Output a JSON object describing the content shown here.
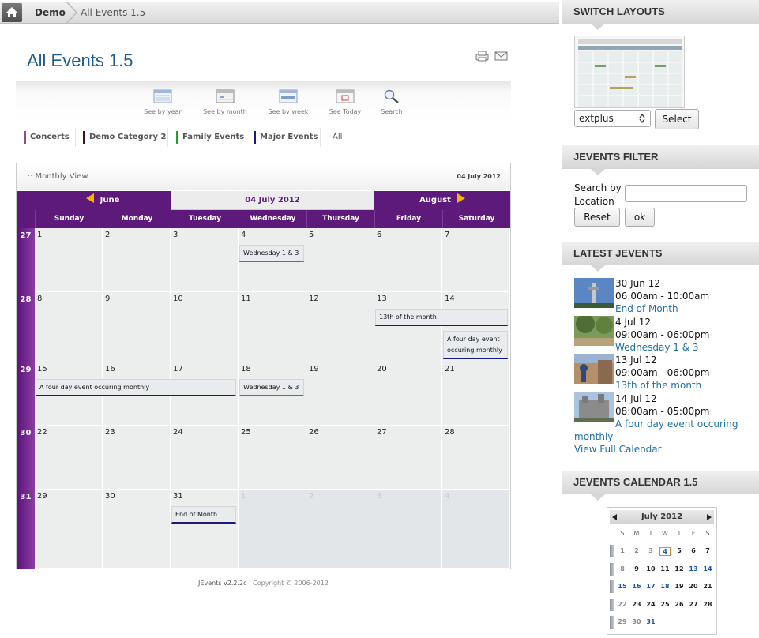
{
  "breadcrumb": {
    "demo": "Demo",
    "current": "All Events 1.5"
  },
  "page": {
    "title": "All Events 1.5"
  },
  "nav": [
    {
      "label": "See by year"
    },
    {
      "label": "See by month"
    },
    {
      "label": "See by week"
    },
    {
      "label": "See Today"
    },
    {
      "label": "Search"
    }
  ],
  "categories": [
    {
      "label": "Concerts",
      "color": "#8a4b8e"
    },
    {
      "label": "Demo Category 2",
      "color": "#4a1010"
    },
    {
      "label": "Family Events",
      "color": "#2e9a2e"
    },
    {
      "label": "Major Events",
      "color": "#1a1a7a"
    },
    {
      "label": "All",
      "color": ""
    }
  ],
  "calendar": {
    "view_label": "Monthly View",
    "date_label": "04 July 2012",
    "prev_month": "June",
    "current": "04 July 2012",
    "next_month": "August",
    "days": [
      "Sunday",
      "Monday",
      "Tuesday",
      "Wednesday",
      "Thursday",
      "Friday",
      "Saturday"
    ],
    "weeks": [
      {
        "num": "27",
        "days": [
          "1",
          "2",
          "3",
          "4",
          "5",
          "6",
          "7"
        ]
      },
      {
        "num": "28",
        "days": [
          "8",
          "9",
          "10",
          "11",
          "12",
          "13",
          "14"
        ]
      },
      {
        "num": "29",
        "days": [
          "15",
          "16",
          "17",
          "18",
          "19",
          "20",
          "21"
        ]
      },
      {
        "num": "30",
        "days": [
          "22",
          "23",
          "24",
          "25",
          "26",
          "27",
          "28"
        ]
      },
      {
        "num": "31",
        "days": [
          "29",
          "30",
          "31",
          "1",
          "2",
          "3",
          "4"
        ]
      }
    ],
    "events": {
      "wed1": "Wednesday 1 & 3",
      "thirteenth": "13th of the month",
      "fourday_short": "A four day event occuring monthly",
      "fourday_long": "A four day event occuring monthly",
      "wed2": "Wednesday 1 & 3",
      "eom": "End of Month"
    },
    "event_colors": {
      "green": "#2e9a2e",
      "navy": "#1a1a7a"
    }
  },
  "footer": {
    "version": "JEvents v2.2.2c",
    "copyright": "Copyright © 2006-2012"
  },
  "sidebar": {
    "switch_layouts": {
      "title": "SWITCH LAYOUTS",
      "selected": "extplus",
      "button": "Select"
    },
    "filter": {
      "title": "JEVENTS FILTER",
      "label": "Search by Location",
      "reset": "Reset",
      "ok": "ok"
    },
    "latest": {
      "title": "LATEST JEVENTS",
      "items": [
        {
          "date": "30 Jun 12",
          "time": "06:00am - 10:00am",
          "title": "End of Month"
        },
        {
          "date": "4 Jul 12",
          "time": "09:00am - 06:00pm",
          "title": "Wednesday 1 & 3"
        },
        {
          "date": "13 Jul 12",
          "time": "09:00am - 06:00pm",
          "title": "13th of the month"
        },
        {
          "date": "14 Jul 12",
          "time": "08:00am - 05:00pm",
          "title_line1": "A four day event occuring",
          "title_line2": "monthly"
        }
      ],
      "view_full": "View Full Calendar"
    },
    "minical": {
      "title": "JEVENTS CALENDAR 1.5",
      "month": "July 2012",
      "dow": [
        "S",
        "M",
        "T",
        "W",
        "T",
        "F",
        "S"
      ],
      "rows": [
        [
          "1",
          "2",
          "3",
          "4",
          "5",
          "6",
          "7"
        ],
        [
          "8",
          "9",
          "10",
          "11",
          "12",
          "13",
          "14"
        ],
        [
          "15",
          "16",
          "17",
          "18",
          "19",
          "20",
          "21"
        ],
        [
          "22",
          "23",
          "24",
          "25",
          "26",
          "27",
          "28"
        ],
        [
          "29",
          "30",
          "31",
          "",
          "",
          "",
          ""
        ]
      ]
    }
  }
}
